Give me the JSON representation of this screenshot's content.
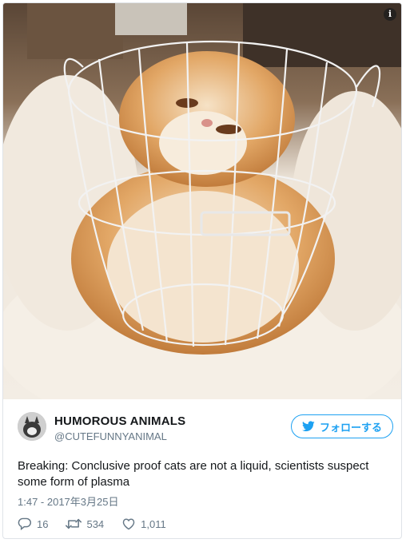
{
  "tweet": {
    "display_name": "HUMOROUS ANIMALS",
    "handle": "@CUTEFUNNYANIMAL",
    "follow_label": "フォローする",
    "text": "Breaking: Conclusive proof cats are not a liquid, scientists suspect some form of plasma",
    "timestamp": "1:47 - 2017年3月25日",
    "replies": "16",
    "retweets": "534",
    "likes": "1,011",
    "info_icon_glyph": "i"
  },
  "icons": {
    "info": "info-icon",
    "bird": "twitter-bird-icon",
    "reply": "reply-icon",
    "retweet": "retweet-icon",
    "like": "heart-icon"
  },
  "colors": {
    "accent": "#1da1f2",
    "text": "#14171a",
    "muted": "#657786"
  }
}
